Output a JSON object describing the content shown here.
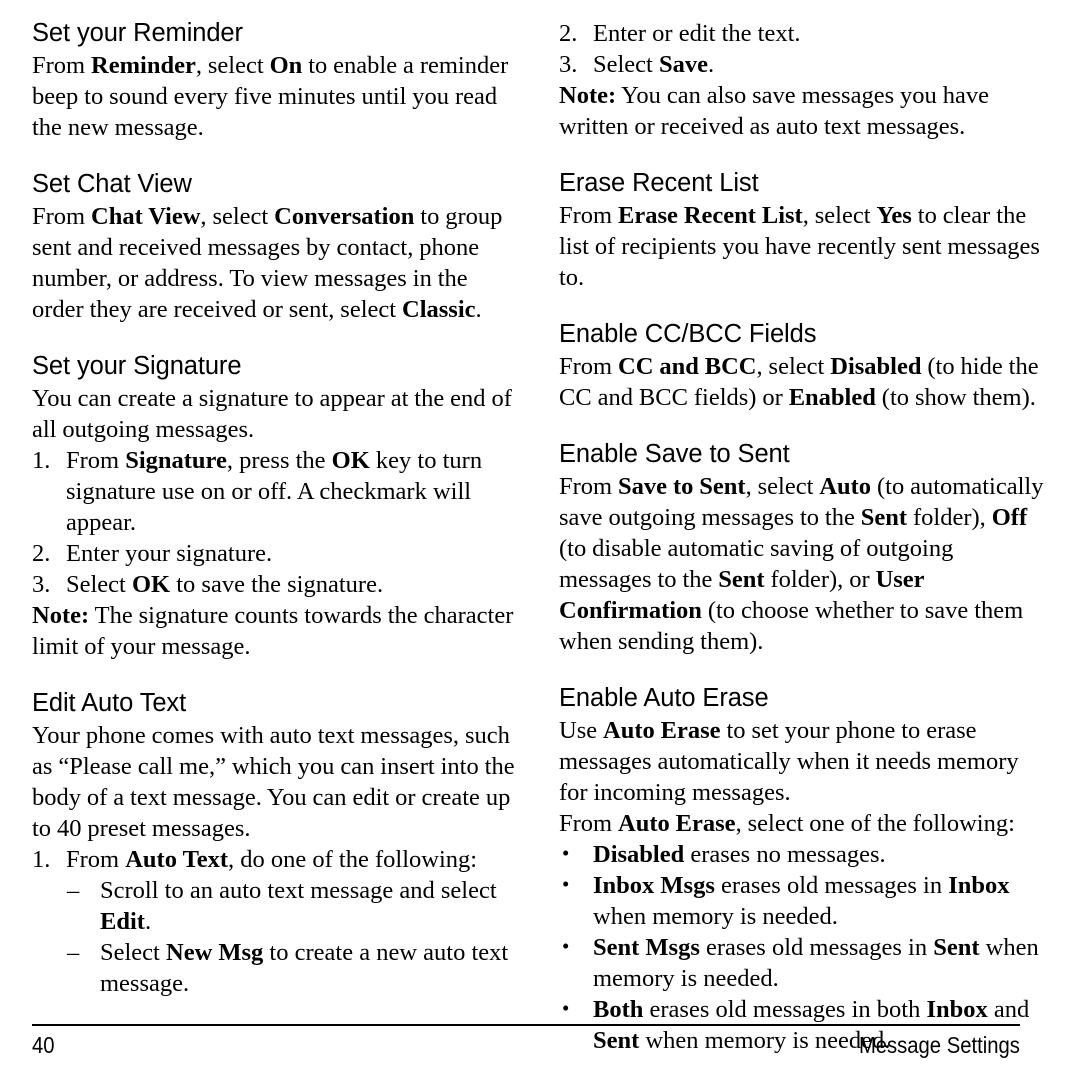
{
  "page": {
    "footer_page_number": "40",
    "footer_section_title": "Message Settings"
  },
  "left_column": {
    "sections": [
      {
        "heading": "Set your Reminder",
        "paragraphs": [
          {
            "runs": [
              {
                "t": "From ",
                "b": false
              },
              {
                "t": "Reminder",
                "b": true
              },
              {
                "t": ", select ",
                "b": false
              },
              {
                "t": "On",
                "b": true
              },
              {
                "t": " to enable a reminder beep to sound every five minutes until you read the new message.",
                "b": false
              }
            ]
          }
        ]
      },
      {
        "heading": "Set Chat View",
        "paragraphs": [
          {
            "runs": [
              {
                "t": "From ",
                "b": false
              },
              {
                "t": "Chat View",
                "b": true
              },
              {
                "t": ", select ",
                "b": false
              },
              {
                "t": "Conversation",
                "b": true
              },
              {
                "t": " to group sent and received messages by contact, phone number, or address. To view messages in the order they are received or sent, select ",
                "b": false
              },
              {
                "t": "Classic",
                "b": true
              },
              {
                "t": ".",
                "b": false
              }
            ]
          }
        ]
      },
      {
        "heading": "Set your Signature",
        "paragraphs": [
          {
            "runs": [
              {
                "t": "You can create a signature to appear at the end of all outgoing messages.",
                "b": false
              }
            ]
          }
        ],
        "numbered_list": [
          {
            "marker": "1.",
            "runs": [
              {
                "t": "From ",
                "b": false
              },
              {
                "t": "Signature",
                "b": true
              },
              {
                "t": ", press the ",
                "b": false
              },
              {
                "t": "OK",
                "b": true
              },
              {
                "t": " key to turn signature use on or off. A checkmark will appear.",
                "b": false
              }
            ]
          },
          {
            "marker": "2.",
            "runs": [
              {
                "t": "Enter your signature.",
                "b": false
              }
            ]
          },
          {
            "marker": "3.",
            "runs": [
              {
                "t": "Select ",
                "b": false
              },
              {
                "t": "OK",
                "b": true
              },
              {
                "t": " to save the signature.",
                "b": false
              }
            ]
          }
        ],
        "note": {
          "runs": [
            {
              "t": "Note:",
              "b": true
            },
            {
              "t": " The signature counts towards the character limit of your message.",
              "b": false
            }
          ]
        }
      },
      {
        "heading": "Edit Auto Text",
        "paragraphs": [
          {
            "runs": [
              {
                "t": "Your phone comes with auto text messages, such as “Please call me,” which you can insert into the body of a text message. You can edit or create up to 40 preset messages.",
                "b": false
              }
            ]
          }
        ],
        "numbered_list": [
          {
            "marker": "1.",
            "runs": [
              {
                "t": "From ",
                "b": false
              },
              {
                "t": "Auto Text",
                "b": true
              },
              {
                "t": ", do one of the following:",
                "b": false
              }
            ]
          }
        ],
        "dash_list": [
          {
            "marker": "–",
            "runs": [
              {
                "t": "Scroll to an auto text message and select ",
                "b": false
              },
              {
                "t": "Edit",
                "b": true
              },
              {
                "t": ".",
                "b": false
              }
            ]
          },
          {
            "marker": "–",
            "runs": [
              {
                "t": "Select ",
                "b": false
              },
              {
                "t": "New Msg",
                "b": true
              },
              {
                "t": " to create a new auto text message.",
                "b": false
              }
            ]
          }
        ]
      }
    ]
  },
  "right_column": {
    "continued_numbered_list": [
      {
        "marker": "2.",
        "runs": [
          {
            "t": "Enter or edit the text.",
            "b": false
          }
        ]
      },
      {
        "marker": "3.",
        "runs": [
          {
            "t": "Select ",
            "b": false
          },
          {
            "t": "Save",
            "b": true
          },
          {
            "t": ".",
            "b": false
          }
        ]
      }
    ],
    "continued_note": {
      "runs": [
        {
          "t": "Note:",
          "b": true
        },
        {
          "t": " You can also save messages you have written or received as auto text messages.",
          "b": false
        }
      ]
    },
    "sections": [
      {
        "heading": "Erase Recent List",
        "paragraphs": [
          {
            "runs": [
              {
                "t": "From ",
                "b": false
              },
              {
                "t": "Erase Recent List",
                "b": true
              },
              {
                "t": ", select ",
                "b": false
              },
              {
                "t": "Yes",
                "b": true
              },
              {
                "t": " to clear the list of recipients you have recently sent messages to.",
                "b": false
              }
            ]
          }
        ]
      },
      {
        "heading": "Enable CC/BCC Fields",
        "paragraphs": [
          {
            "runs": [
              {
                "t": "From ",
                "b": false
              },
              {
                "t": "CC and BCC",
                "b": true
              },
              {
                "t": ", select ",
                "b": false
              },
              {
                "t": "Disabled",
                "b": true
              },
              {
                "t": " (to hide the CC and BCC fields) or ",
                "b": false
              },
              {
                "t": "Enabled",
                "b": true
              },
              {
                "t": " (to show them).",
                "b": false
              }
            ]
          }
        ]
      },
      {
        "heading": "Enable Save to Sent",
        "paragraphs": [
          {
            "runs": [
              {
                "t": "From ",
                "b": false
              },
              {
                "t": "Save to Sent",
                "b": true
              },
              {
                "t": ", select ",
                "b": false
              },
              {
                "t": "Auto",
                "b": true
              },
              {
                "t": " (to automatically save outgoing messages to the ",
                "b": false
              },
              {
                "t": "Sent",
                "b": true
              },
              {
                "t": " folder), ",
                "b": false
              },
              {
                "t": "Off",
                "b": true
              },
              {
                "t": " (to disable automatic saving of outgoing messages to the ",
                "b": false
              },
              {
                "t": "Sent",
                "b": true
              },
              {
                "t": " folder), or ",
                "b": false
              },
              {
                "t": "User Confirmation",
                "b": true
              },
              {
                "t": " (to choose whether to save them when sending them).",
                "b": false
              }
            ]
          }
        ]
      },
      {
        "heading": "Enable Auto Erase",
        "paragraphs": [
          {
            "runs": [
              {
                "t": "Use ",
                "b": false
              },
              {
                "t": "Auto Erase",
                "b": true
              },
              {
                "t": " to set your phone to erase messages automatically when it needs memory for incoming messages.",
                "b": false
              }
            ]
          },
          {
            "runs": [
              {
                "t": "From ",
                "b": false
              },
              {
                "t": "Auto Erase",
                "b": true
              },
              {
                "t": ", select one of the following:",
                "b": false
              }
            ]
          }
        ],
        "bullet_list": [
          {
            "marker": "•",
            "runs": [
              {
                "t": "Disabled",
                "b": true
              },
              {
                "t": " erases no messages.",
                "b": false
              }
            ]
          },
          {
            "marker": "•",
            "runs": [
              {
                "t": "Inbox Msgs",
                "b": true
              },
              {
                "t": " erases old messages in ",
                "b": false
              },
              {
                "t": "Inbox",
                "b": true
              },
              {
                "t": " when memory is needed.",
                "b": false
              }
            ]
          },
          {
            "marker": "•",
            "runs": [
              {
                "t": "Sent Msgs",
                "b": true
              },
              {
                "t": " erases old messages in ",
                "b": false
              },
              {
                "t": "Sent",
                "b": true
              },
              {
                "t": " when memory is needed.",
                "b": false
              }
            ]
          },
          {
            "marker": "•",
            "runs": [
              {
                "t": "Both",
                "b": true
              },
              {
                "t": " erases old messages in both ",
                "b": false
              },
              {
                "t": "Inbox",
                "b": true
              },
              {
                "t": " and ",
                "b": false
              },
              {
                "t": "Sent",
                "b": true
              },
              {
                "t": " when memory is needed.",
                "b": false
              }
            ]
          }
        ]
      }
    ]
  }
}
